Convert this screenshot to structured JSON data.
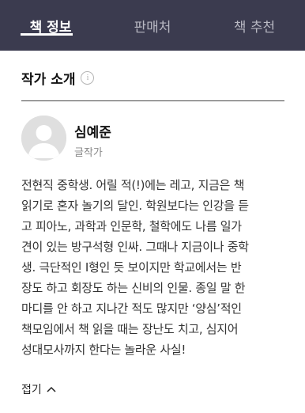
{
  "tabs": [
    {
      "label": "책 정보",
      "active": true
    },
    {
      "label": "판매처",
      "active": false
    },
    {
      "label": "책 추천",
      "active": false
    }
  ],
  "section": {
    "title": "작가 소개",
    "info_icon": "info-icon"
  },
  "author": {
    "name": "심예준",
    "role": "글작가",
    "avatar_icon": "person-placeholder-icon"
  },
  "bio_lines": [
    "전현직 중학생. 어릴 적(!)에는 레고, 지금은 책",
    "읽기로 혼자 놀기의 달인. 학원보다는 인강을 듣",
    "고 피아노, 과학과 인문학, 철학에도 나름 일가",
    "견이 있는 방구석형 인싸. 그때나 지금이나 중학",
    "생. 극단적인 I형인 듯 보이지만 학교에서는 반",
    "장도 하고 회장도 하는 신비의 인물. 종일 말 한",
    "마디를 안 하고 지나간 적도 많지만 ‘양심’적인",
    "책모임에서 책 읽을 때는 장난도 치고, 심지어",
    "성대모사까지 한다는 놀라운 사실!"
  ],
  "collapse": {
    "label": "접기",
    "icon": "chevron-up-icon"
  },
  "colors": {
    "tabbar_bg": "#3b3b4f",
    "tab_active": "#ffffff",
    "tab_inactive": "#b8b8c2"
  }
}
